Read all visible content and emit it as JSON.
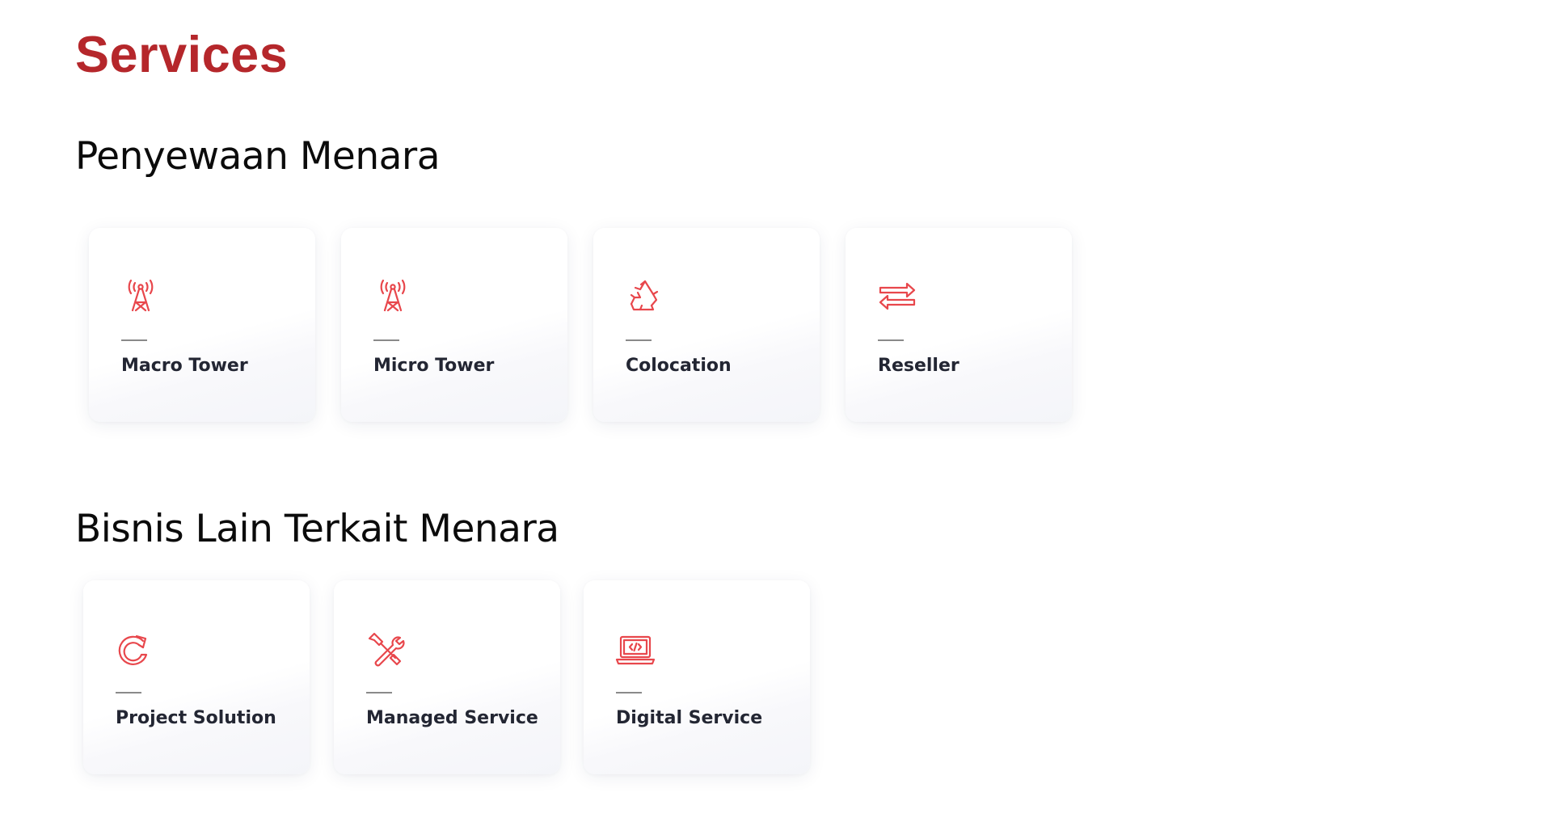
{
  "page": {
    "title": "Services"
  },
  "sections": [
    {
      "title": "Penyewaan Menara",
      "cards": [
        {
          "label": "Macro Tower",
          "icon": "antenna-tower-icon"
        },
        {
          "label": "Micro Tower",
          "icon": "antenna-tower-icon"
        },
        {
          "label": "Colocation",
          "icon": "recycle-icon"
        },
        {
          "label": "Reseller",
          "icon": "swap-arrows-icon"
        }
      ]
    },
    {
      "title": "Bisnis Lain Terkait Menara",
      "cards": [
        {
          "label": "Project Solution",
          "icon": "refresh-arrow-icon"
        },
        {
          "label": "Managed Service",
          "icon": "wrench-screwdriver-icon"
        },
        {
          "label": "Digital Service",
          "icon": "laptop-code-icon"
        }
      ]
    }
  ],
  "colors": {
    "brand": "#b5272b",
    "icon": "#e8474c",
    "card_label": "#232633"
  }
}
